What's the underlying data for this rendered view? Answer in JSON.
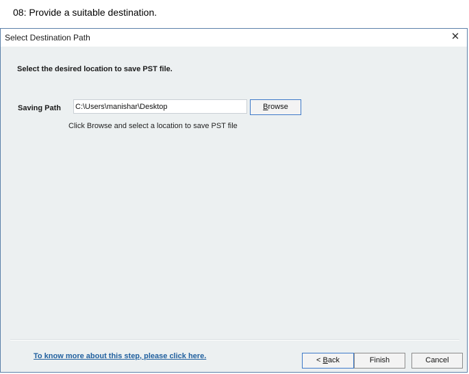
{
  "caption": "08: Provide a suitable destination.",
  "dialog": {
    "title": "Select Destination Path",
    "close_glyph": "✕",
    "instruction": "Select the desired location to save PST file.",
    "saving_path": {
      "label": "Saving Path",
      "value": "C:\\Users\\manishar\\Desktop",
      "browse_label_prefix": "",
      "browse_label_underline": "B",
      "browse_label_rest": "rowse"
    },
    "hint": "Click Browse and select a location to save PST file",
    "help_link": "To know more about this step, please click here.",
    "buttons": {
      "back_prefix": "< ",
      "back_underline": "B",
      "back_rest": "ack",
      "finish": "Finish",
      "cancel": "Cancel"
    }
  }
}
